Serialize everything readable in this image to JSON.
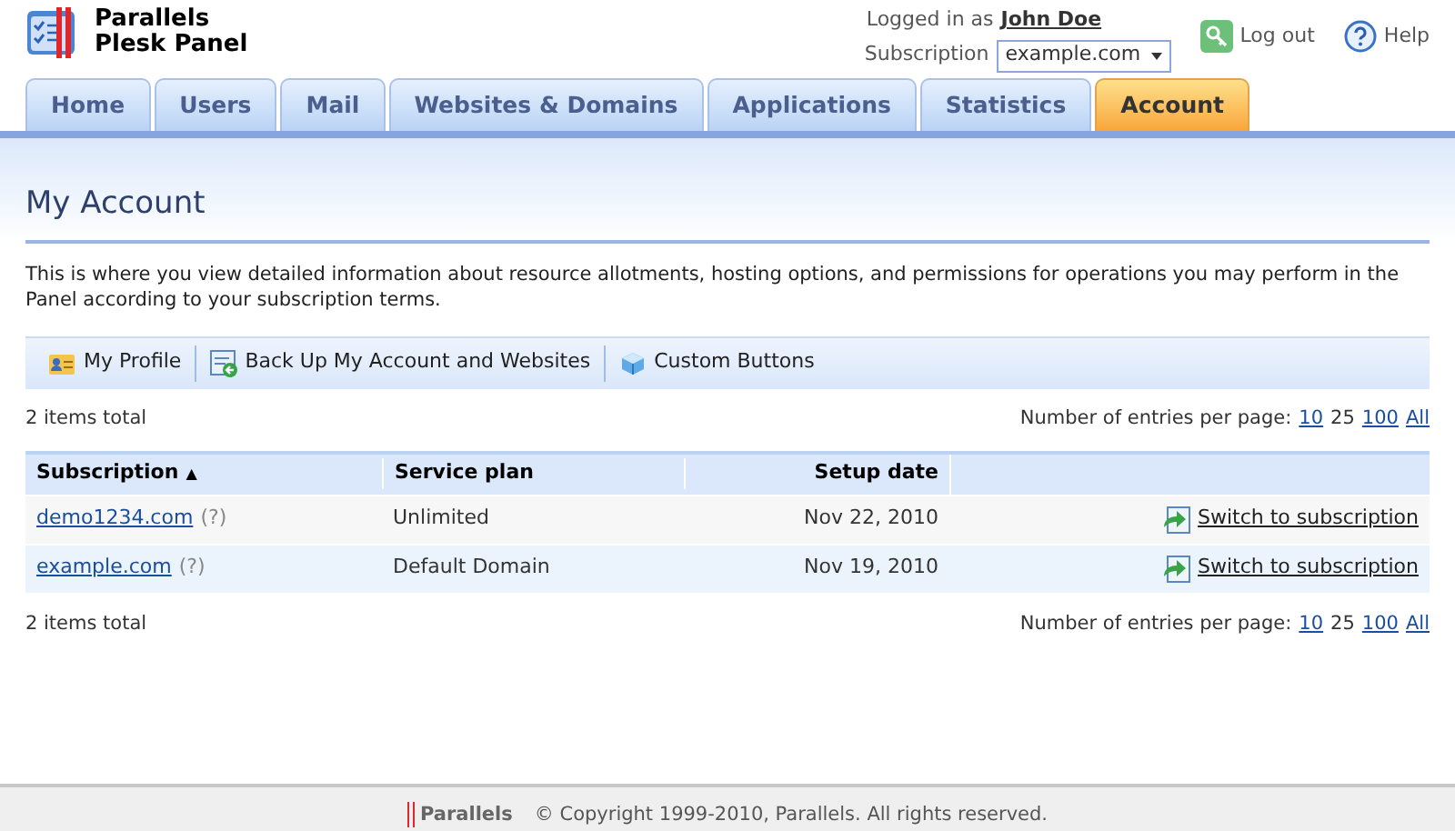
{
  "brand": {
    "line1": "Parallels",
    "line2": "Plesk Panel"
  },
  "user": {
    "logged_label": "Logged in as",
    "name": "John Doe",
    "subscription_label": "Subscription",
    "subscription_value": "example.com"
  },
  "header_links": [
    {
      "kind": "logout",
      "label": "Log out"
    },
    {
      "kind": "help",
      "label": "Help"
    }
  ],
  "tabs": [
    {
      "label": "Home",
      "selected": false
    },
    {
      "label": "Users",
      "selected": false
    },
    {
      "label": "Mail",
      "selected": false
    },
    {
      "label": "Websites & Domains",
      "selected": false
    },
    {
      "label": "Applications",
      "selected": false
    },
    {
      "label": "Statistics",
      "selected": false
    },
    {
      "label": "Account",
      "selected": true
    }
  ],
  "page_title": "My Account",
  "description": "This is where you view detailed information about resource allotments, hosting options, and permissions for operations you may perform in the Panel according to your subscription terms.",
  "toolbar": [
    {
      "kind": "profile",
      "label": "My Profile"
    },
    {
      "kind": "backup",
      "label": "Back Up My Account and Websites"
    },
    {
      "kind": "custom",
      "label": "Custom Buttons"
    }
  ],
  "items_total": "2 items total",
  "per_page": {
    "label": "Number of entries per page:",
    "options": [
      {
        "label": "10",
        "selected": false
      },
      {
        "label": "25",
        "selected": true
      },
      {
        "label": "100",
        "selected": false
      },
      {
        "label": "All",
        "selected": false
      }
    ]
  },
  "table": {
    "columns": [
      "Subscription",
      "Service plan",
      "Setup date"
    ],
    "sort_mark": "▲",
    "rows": [
      {
        "subscription": "demo1234.com",
        "hint": "(?)",
        "plan": "Unlimited",
        "date": "Nov 22, 2010",
        "action": "Switch to subscription"
      },
      {
        "subscription": "example.com",
        "hint": "(?)",
        "plan": "Default Domain",
        "date": "Nov 19, 2010",
        "action": "Switch to subscription"
      }
    ]
  },
  "items_total_bottom": "2 items total",
  "per_page_bottom": {
    "label": "Number of entries per page:",
    "options": [
      {
        "label": "10",
        "selected": false
      },
      {
        "label": "25",
        "selected": true
      },
      {
        "label": "100",
        "selected": false
      },
      {
        "label": "All",
        "selected": false
      }
    ]
  },
  "footer": {
    "logo": "Parallels",
    "copyright": "© Copyright 1999-2010, Parallels. All rights reserved."
  }
}
